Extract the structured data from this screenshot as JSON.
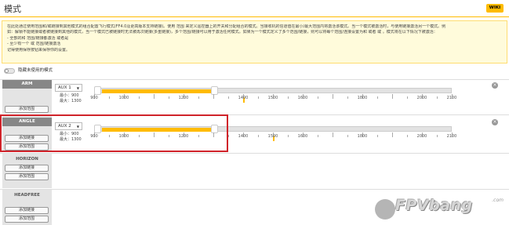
{
  "header": {
    "title": "模式",
    "wiki_label": "WIKI"
  },
  "notice": {
    "lines": [
      "在此处通过使用范围和/或链接到其他模式的组合配置飞行模式(FF4.0及更高版本支持链接)。使用 范围 来定义遥控器上的开关和分配组合的模式。当接收机的信道值在最小/最大范围内将激活该模式。当一个模式被激活时，与使用链接激活另一个模式。例",
      "如：解锁不能链接或者被链接到其他的模式，当一个模式已被链接时无法被再次链接(多重链接)，多个范围/链接可以用于激活任何模式。如果为一个模式定义了多个范围/链接，则可以将每个范围/连接设置为和 或者 或 。模式将在以下情况下被激活：",
      "- 全部的和 范围/链接都激活 或者是",
      "- 至少有一个 或 范围/链接激活",
      "",
      "记得使用保存按钮来保存你的设置。"
    ]
  },
  "toggle": {
    "label": "隐藏未使用的模式",
    "on": false
  },
  "modes": [
    {
      "name": "ARM",
      "buttons": [
        "添加范围"
      ],
      "range": {
        "channel": "AUX 1",
        "min_label": "最小：900",
        "max_label": "最大：1300",
        "min": 900,
        "max": 1300,
        "marker": 1400
      }
    },
    {
      "name": "ANGLE",
      "buttons": [
        "添加链接",
        "添加范围"
      ],
      "range": {
        "channel": "AUX 2",
        "min_label": "最小：900",
        "max_label": "最大：1300",
        "min": 900,
        "max": 1300,
        "marker": 1500
      }
    },
    {
      "name": "HORIZON",
      "buttons": [
        "添加链接",
        "添加范围"
      ]
    },
    {
      "name": "HEADFREE",
      "buttons": [
        "添加链接",
        "添加范围"
      ]
    }
  ],
  "scale": {
    "min": 900,
    "max": 2100,
    "labels": [
      "900",
      "1000",
      "1200",
      "1400",
      "1500",
      "1600",
      "1800",
      "2000",
      "2100"
    ]
  },
  "watermark": {
    "text": "FPVbang",
    "domain": ".com"
  },
  "colors": {
    "accent": "#ffbb00",
    "highlight": "#d0232a",
    "mode_header": "#878787"
  }
}
